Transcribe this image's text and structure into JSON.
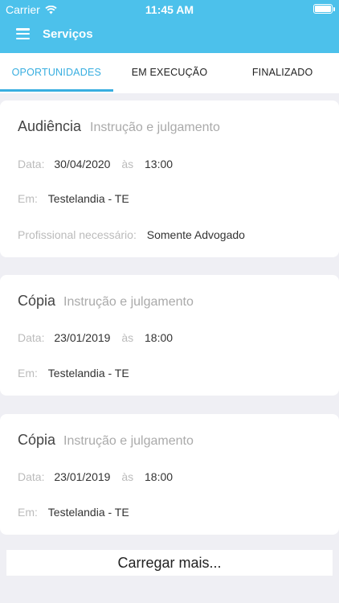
{
  "status_bar": {
    "carrier": "Carrier",
    "time": "11:45 AM"
  },
  "header": {
    "title": "Serviços",
    "menu_icon": "hamburger-menu-icon"
  },
  "tabs": [
    {
      "label": "OPORTUNIDADES",
      "active": true
    },
    {
      "label": "EM EXECUÇÃO",
      "active": false
    },
    {
      "label": "FINALIZADO",
      "active": false
    }
  ],
  "labels": {
    "date": "Data:",
    "at": "às",
    "location": "Em:",
    "professional": "Profissional necessário:"
  },
  "cards": [
    {
      "title": "Audiência",
      "subtitle": "Instrução e julgamento",
      "date": "30/04/2020",
      "time": "13:00",
      "location": "Testelandia - TE",
      "professional": "Somente Advogado"
    },
    {
      "title": "Cópia",
      "subtitle": "Instrução e julgamento",
      "date": "23/01/2019",
      "time": "18:00",
      "location": "Testelandia - TE"
    },
    {
      "title": "Cópia",
      "subtitle": "Instrução e julgamento",
      "date": "23/01/2019",
      "time": "18:00",
      "location": "Testelandia - TE"
    }
  ],
  "load_more_label": "Carregar mais...",
  "colors": {
    "header": "#4cc1eb",
    "active_tab": "#38aee0",
    "background": "#efeff4"
  }
}
